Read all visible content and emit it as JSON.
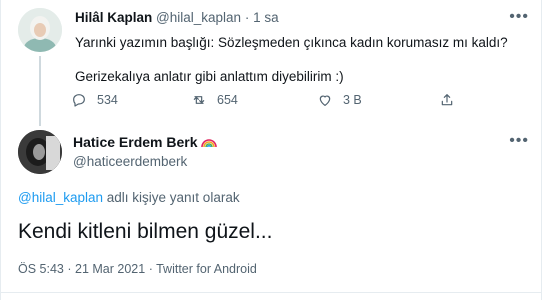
{
  "parent_tweet": {
    "display_name": "Hilâl Kaplan",
    "handle": "@hilal_kaplan",
    "separator": "·",
    "time": "1 sa",
    "more_icon": "more-horizontal-icon",
    "text_line1": "Yarınki yazımın başlığı: Sözleşmeden çıkınca kadın korumasız mı kaldı?",
    "text_line2": "Gerizekalıya anlatır gibi anlattım diyebilirim :)",
    "actions": {
      "reply_count": "534",
      "retweet_count": "654",
      "like_count": "3 B"
    }
  },
  "main_tweet": {
    "display_name": "Hatice Erdem Berk",
    "name_emoji": "rainbow",
    "handle": "@haticeerdemberk",
    "reply_prefix": "@hilal_kaplan",
    "reply_suffix": " adlı kişiye yanıt olarak",
    "text": "Kendi kitleni bilmen güzel...",
    "time": "ÖS 5:43",
    "separator": "·",
    "date": "21 Mar 2021",
    "source": "Twitter for Android"
  },
  "colors": {
    "link": "#1d9bf0",
    "secondary": "#536471",
    "primary": "#0f1419"
  }
}
